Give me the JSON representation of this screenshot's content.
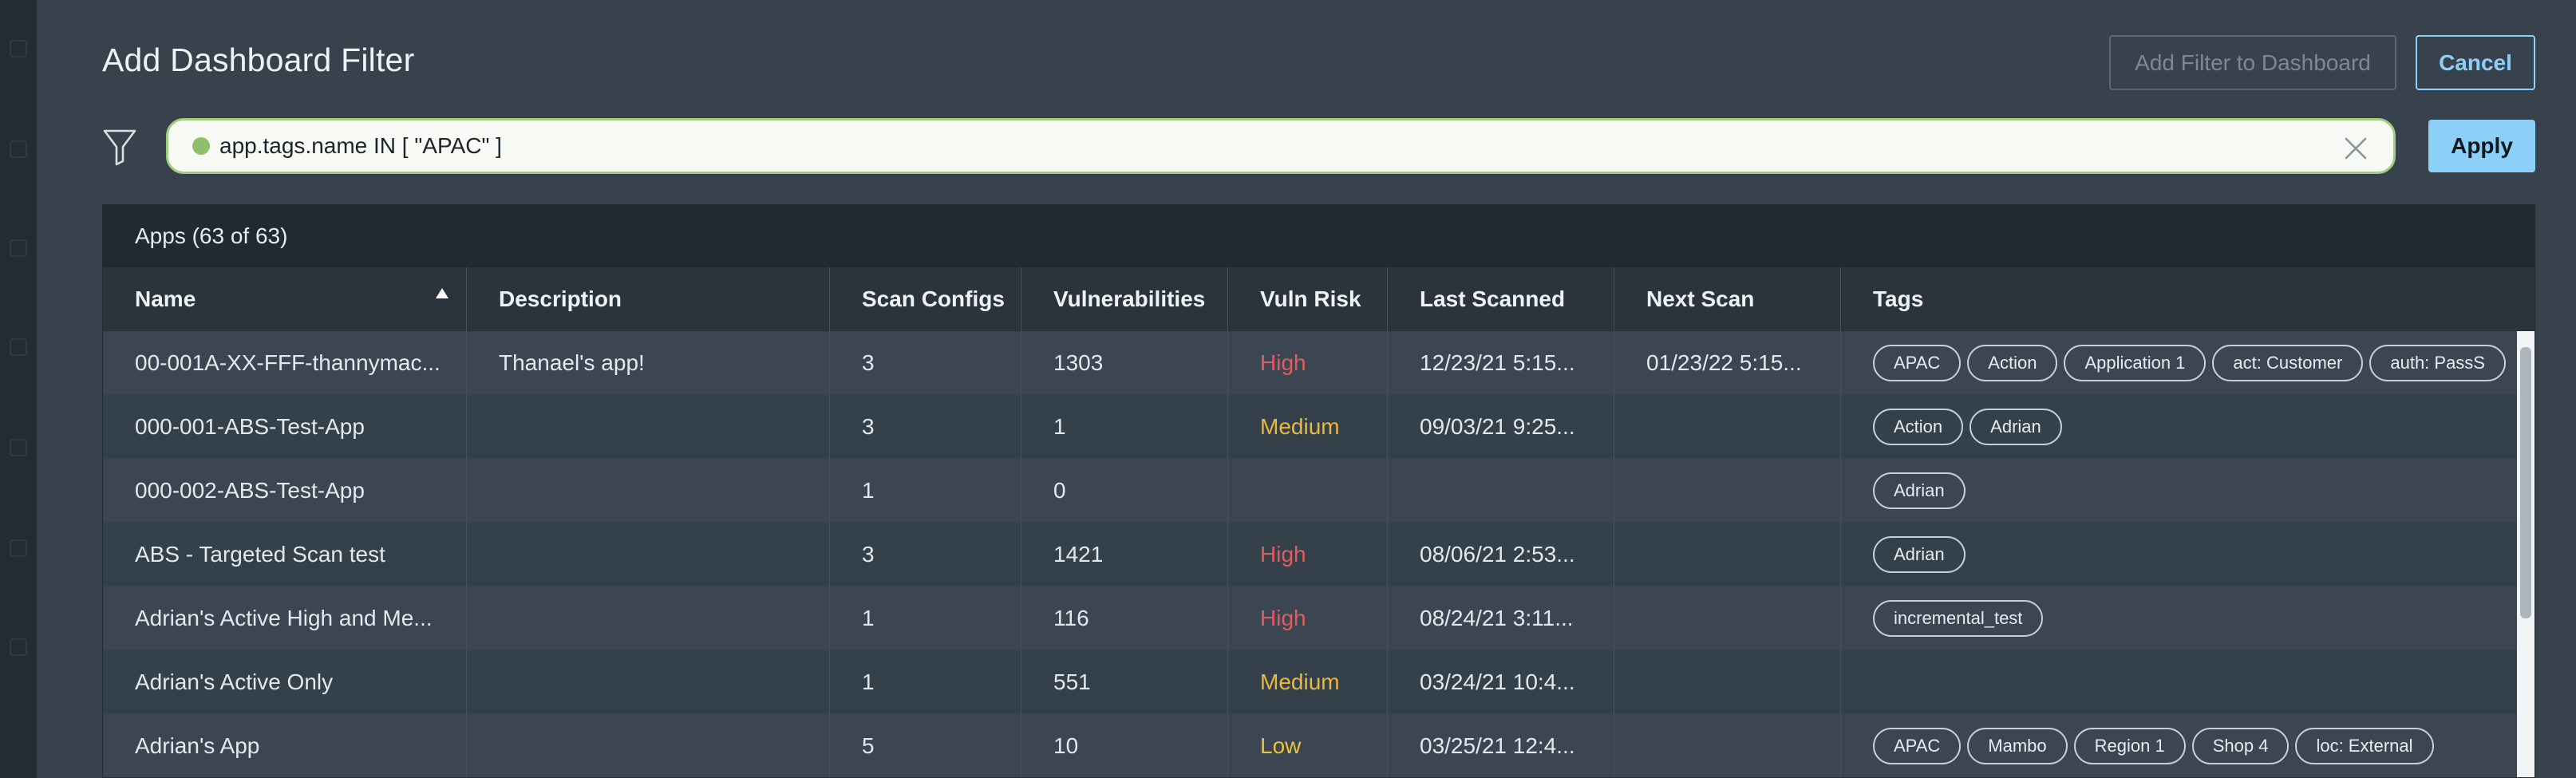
{
  "dialog": {
    "title": "Add Dashboard Filter",
    "add_button": "Add Filter to Dashboard",
    "cancel_button": "Cancel"
  },
  "filter": {
    "query": "app.tags.name IN [ \"APAC\" ]",
    "apply_button": "Apply"
  },
  "table": {
    "count_label": "Apps (63 of 63)",
    "sorted_column": "Name",
    "columns": [
      "Name",
      "Description",
      "Scan Configs",
      "Vulnerabilities",
      "Vuln Risk",
      "Last Scanned",
      "Next Scan",
      "Tags"
    ],
    "rows": [
      {
        "name": "00-001A-XX-FFF-thannymac...",
        "description": "Thanael's app!",
        "scan_configs": "3",
        "vulnerabilities": "1303",
        "risk": "High",
        "last_scanned": "12/23/21 5:15...",
        "next_scan": "01/23/22 5:15...",
        "tags": [
          "APAC",
          "Action",
          "Application 1",
          "act: Customer",
          "auth: PassS"
        ]
      },
      {
        "name": "000-001-ABS-Test-App",
        "description": "",
        "scan_configs": "3",
        "vulnerabilities": "1",
        "risk": "Medium",
        "last_scanned": "09/03/21 9:25...",
        "next_scan": "",
        "tags": [
          "Action",
          "Adrian"
        ]
      },
      {
        "name": "000-002-ABS-Test-App",
        "description": "",
        "scan_configs": "1",
        "vulnerabilities": "0",
        "risk": "",
        "last_scanned": "",
        "next_scan": "",
        "tags": [
          "Adrian"
        ]
      },
      {
        "name": "ABS - Targeted Scan test",
        "description": "",
        "scan_configs": "3",
        "vulnerabilities": "1421",
        "risk": "High",
        "last_scanned": "08/06/21 2:53...",
        "next_scan": "",
        "tags": [
          "Adrian"
        ]
      },
      {
        "name": "Adrian's Active High and Me...",
        "description": "",
        "scan_configs": "1",
        "vulnerabilities": "116",
        "risk": "High",
        "last_scanned": "08/24/21 3:11...",
        "next_scan": "",
        "tags": [
          "incremental_test"
        ]
      },
      {
        "name": "Adrian's Active Only",
        "description": "",
        "scan_configs": "1",
        "vulnerabilities": "551",
        "risk": "Medium",
        "last_scanned": "03/24/21 10:4...",
        "next_scan": "",
        "tags": []
      },
      {
        "name": "Adrian's App",
        "description": "",
        "scan_configs": "5",
        "vulnerabilities": "10",
        "risk": "Low",
        "last_scanned": "03/25/21 12:4...",
        "next_scan": "",
        "tags": [
          "APAC",
          "Mambo",
          "Region 1",
          "Shop 4",
          "loc: External"
        ]
      }
    ]
  },
  "colors": {
    "accent": "#8cd0f7",
    "valid_query": "#8fbf6d",
    "risk_high": "#e35c5c",
    "risk_medium": "#e8b93b",
    "risk_low": "#e8c33b"
  },
  "icons": {
    "filter": "filter-funnel-icon",
    "clear": "close-icon",
    "sort": "sort-ascending-icon"
  }
}
